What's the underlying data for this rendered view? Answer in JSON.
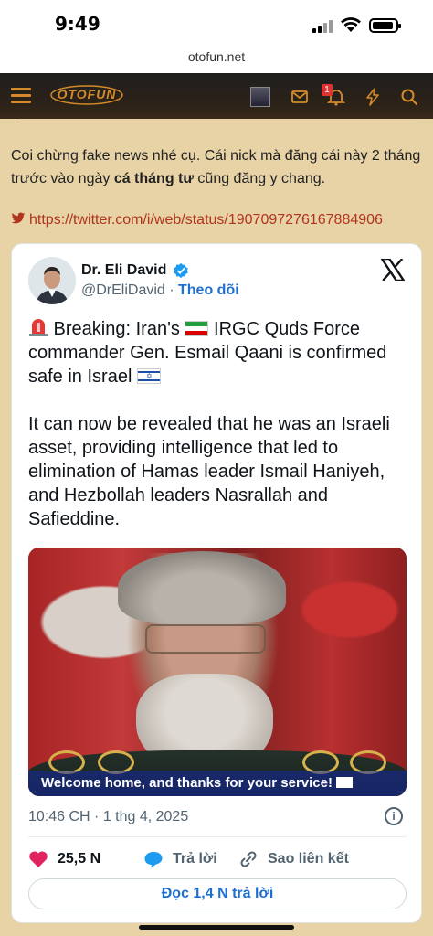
{
  "status_bar": {
    "time": "9:49"
  },
  "browser": {
    "url": "otofun.net"
  },
  "site_header": {
    "logo_text": "OTOFUN",
    "notification_count": "1"
  },
  "post": {
    "text_before": "Coi chừng fake news nhé cụ. Cái nick mà đăng cái này 2 tháng trước vào ngày ",
    "text_bold": "cá tháng tư",
    "text_after": " cũng đăng y chang.",
    "link": "https://twitter.com/i/web/status/1907097276167884906"
  },
  "tweet": {
    "author_name": "Dr. Eli David",
    "handle": "@DrEliDavid",
    "separator": "·",
    "follow_label": "Theo dõi",
    "body": {
      "line1_a": " Breaking: Iran's ",
      "line1_b": " IRGC Quds Force commander Gen. Esmail Qaani is confirmed safe in Israel ",
      "paragraph2": "It can now be revealed that he was an Israeli asset, providing intelligence that led to elimination of Hamas leader Ismail Haniyeh, and Hezbollah leaders Nasrallah and Safieddine."
    },
    "image_caption": "Welcome home, and thanks for your service!",
    "timestamp": "10:46 CH · 1 thg 4, 2025",
    "likes": "25,5 N",
    "reply_label": "Trả lời",
    "copy_link_label": "Sao liên kết",
    "read_replies_label": "Đọc 1,4 N trả lời"
  },
  "colors": {
    "page_bg": "#e8d3a6",
    "accent_orange": "#d48a2a",
    "link_red": "#b0341e",
    "twitter_blue": "#1d6fd0",
    "like_pink": "#e0245e"
  }
}
